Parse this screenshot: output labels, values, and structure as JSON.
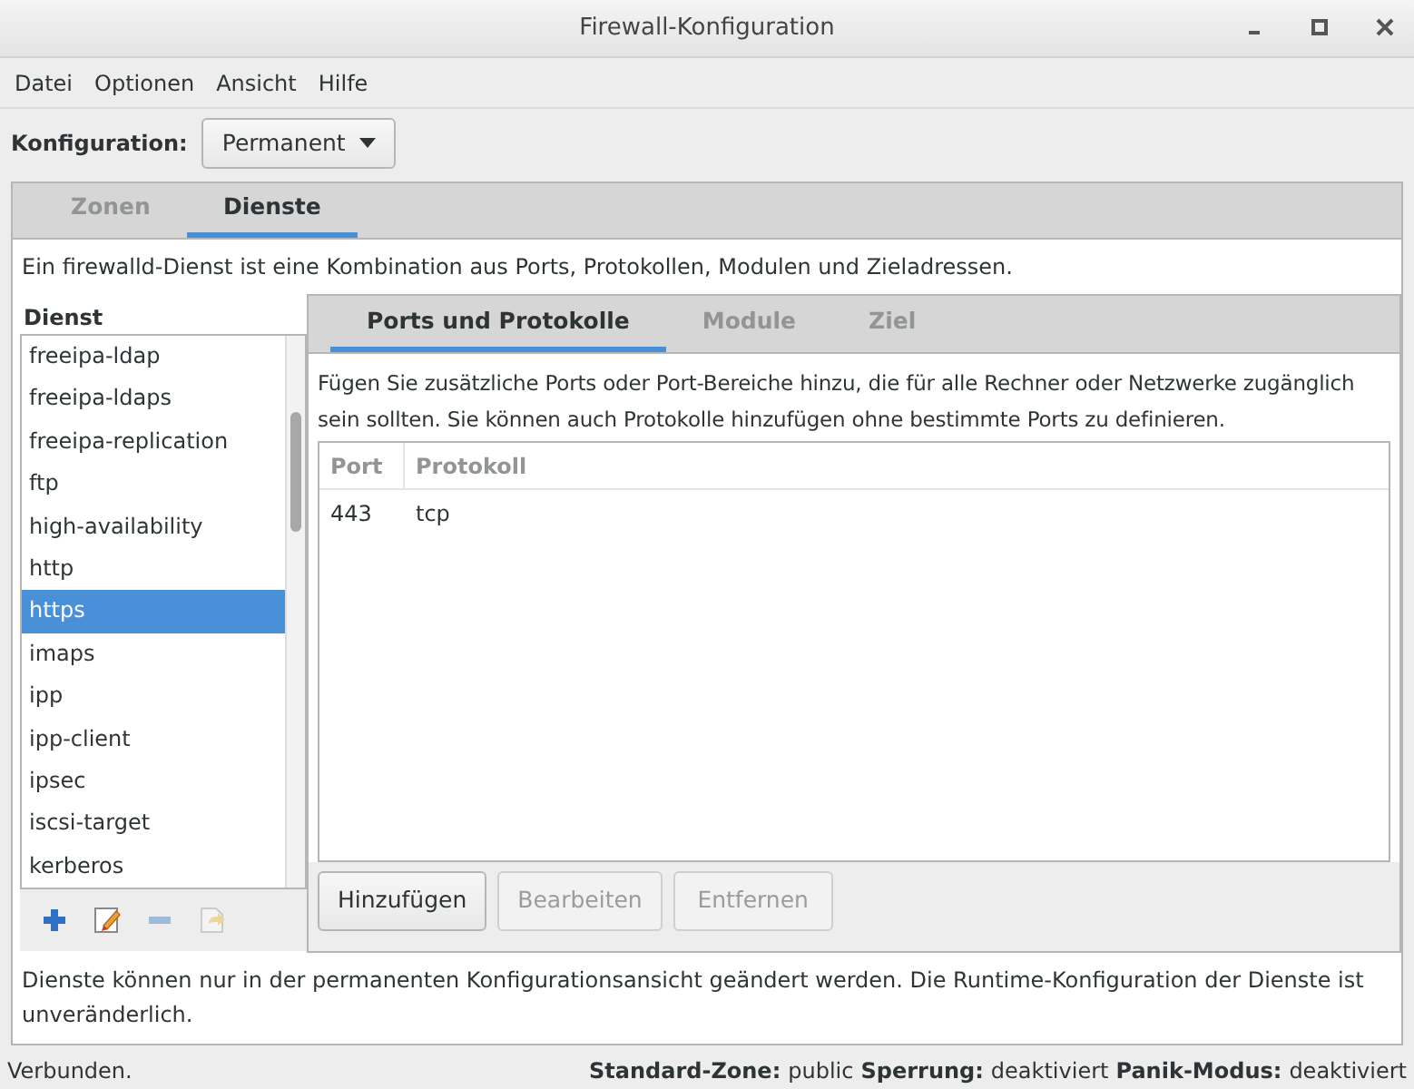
{
  "window": {
    "title": "Firewall-Konfiguration"
  },
  "menu": [
    "Datei",
    "Optionen",
    "Ansicht",
    "Hilfe"
  ],
  "configuration": {
    "label": "Konfiguration:",
    "value": "Permanent"
  },
  "tabs": [
    {
      "label": "Zonen",
      "selected": false
    },
    {
      "label": "Dienste",
      "selected": true
    }
  ],
  "description": "Ein firewalld-Dienst ist eine Kombination aus Ports, Protokollen, Modulen und Zieladressen.",
  "service_list": {
    "heading": "Dienst",
    "items": [
      {
        "label": "freeipa-ldap",
        "selected": false
      },
      {
        "label": "freeipa-ldaps",
        "selected": false
      },
      {
        "label": "freeipa-replication",
        "selected": false
      },
      {
        "label": "ftp",
        "selected": false
      },
      {
        "label": "high-availability",
        "selected": false
      },
      {
        "label": "http",
        "selected": false
      },
      {
        "label": "https",
        "selected": true
      },
      {
        "label": "imaps",
        "selected": false
      },
      {
        "label": "ipp",
        "selected": false
      },
      {
        "label": "ipp-client",
        "selected": false
      },
      {
        "label": "ipsec",
        "selected": false
      },
      {
        "label": "iscsi-target",
        "selected": false
      },
      {
        "label": "kerberos",
        "selected": false
      }
    ],
    "tools": [
      {
        "kind": "add",
        "disabled": false
      },
      {
        "kind": "edit",
        "disabled": false
      },
      {
        "kind": "remove",
        "disabled": true
      },
      {
        "kind": "load",
        "disabled": true
      }
    ]
  },
  "sub_tabs": [
    {
      "label": "Ports und Protokolle",
      "selected": true
    },
    {
      "label": "Module",
      "selected": false
    },
    {
      "label": "Ziel",
      "selected": false
    }
  ],
  "sub_description": "Fügen Sie zusätzliche Ports oder Port-Bereiche hinzu, die für alle Rechner oder Netzwerke zugänglich sein sollten. Sie können auch Protokolle hinzufügen ohne bestimmte Ports zu definieren.",
  "table": {
    "columns": [
      "Port",
      "Protokoll"
    ],
    "rows": [
      [
        "443",
        "tcp"
      ]
    ]
  },
  "buttons": [
    {
      "label": "Hinzufügen",
      "disabled": false
    },
    {
      "label": "Bearbeiten",
      "disabled": true
    },
    {
      "label": "Entfernen",
      "disabled": true
    }
  ],
  "note": "Dienste können nur in der permanenten Konfigurationsansicht geändert werden. Die Runtime-Konfiguration der Dienste ist unveränderlich.",
  "status_bar": {
    "message": "Verbunden.",
    "fields": [
      {
        "label": "Standard-Zone:",
        "value": "public"
      },
      {
        "label": "Sperrung:",
        "value": "deaktiviert"
      },
      {
        "label": "Panik-Modus:",
        "value": "deaktiviert"
      }
    ]
  }
}
